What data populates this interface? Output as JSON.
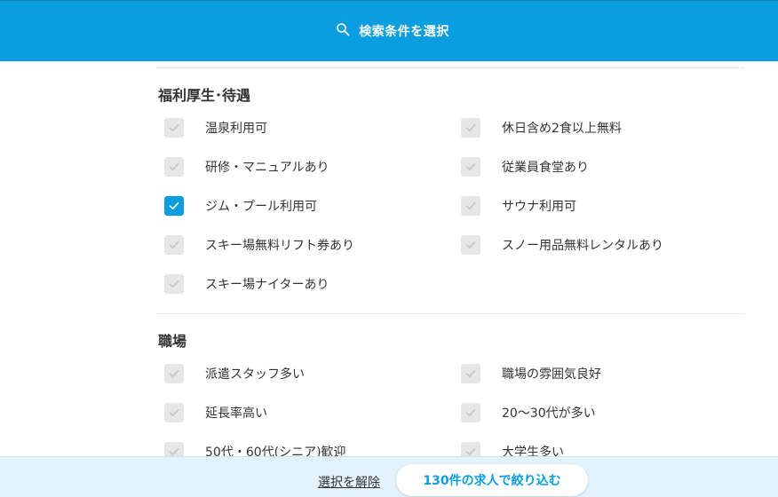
{
  "header": {
    "title": "検索条件を選択",
    "icon": "search-icon"
  },
  "sections": [
    {
      "title": "福利厚生･待遇",
      "options": [
        {
          "label": "温泉利用可",
          "checked": false
        },
        {
          "label": "休日含め2食以上無料",
          "checked": false
        },
        {
          "label": "研修・マニュアルあり",
          "checked": false
        },
        {
          "label": "従業員食堂あり",
          "checked": false
        },
        {
          "label": "ジム・プール利用可",
          "checked": true
        },
        {
          "label": "サウナ利用可",
          "checked": false
        },
        {
          "label": "スキー場無料リフト券あり",
          "checked": false
        },
        {
          "label": "スノー用品無料レンタルあり",
          "checked": false
        },
        {
          "label": "スキー場ナイターあり",
          "checked": false
        }
      ]
    },
    {
      "title": "職場",
      "options": [
        {
          "label": "派遣スタッフ多い",
          "checked": false
        },
        {
          "label": "職場の雰囲気良好",
          "checked": false
        },
        {
          "label": "延長率高い",
          "checked": false
        },
        {
          "label": "20〜30代が多い",
          "checked": false
        },
        {
          "label": "50代・60代(シニア)歓迎",
          "checked": false
        },
        {
          "label": "大学生多い",
          "checked": false
        }
      ]
    }
  ],
  "footer": {
    "clear_label": "選択を解除",
    "apply_label": "130件の求人で絞り込む"
  },
  "colors": {
    "accent": "#0a9ee0",
    "checkbox_off": "#e6e6e6",
    "footer_bg": "#e3f2fc"
  }
}
